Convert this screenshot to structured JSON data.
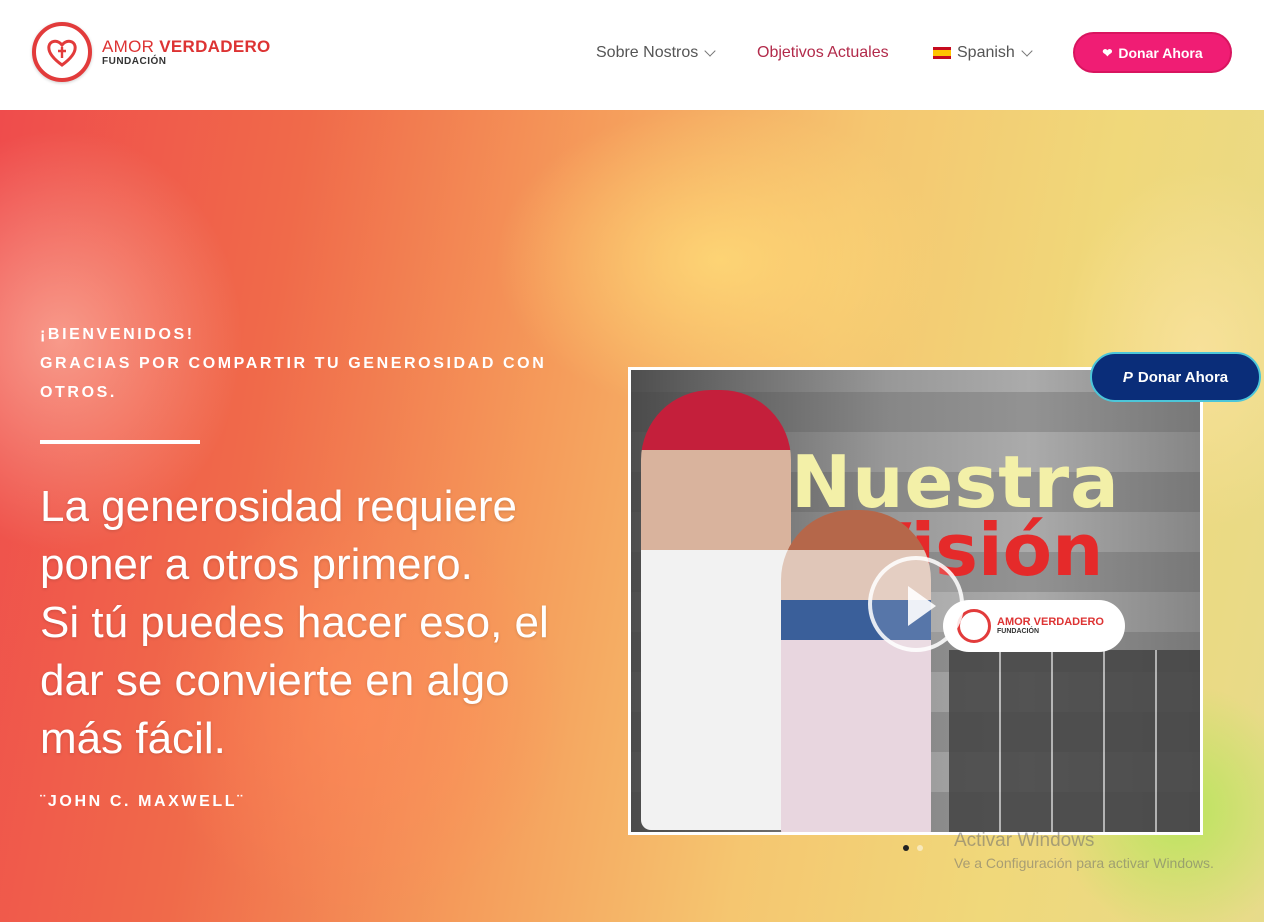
{
  "brand": {
    "name_light": "AMOR",
    "name_bold": "VERDADERO",
    "sub": "FUNDACIÓN"
  },
  "nav": {
    "items": [
      {
        "label": "Sobre Nostros",
        "has_dropdown": true
      },
      {
        "label": "Objetivos Actuales",
        "active": true
      },
      {
        "label": "Spanish",
        "has_dropdown": true,
        "flag": "es"
      }
    ],
    "donate_label": "Donar Ahora",
    "donate_color": "#f01d74",
    "active_color": "#b22a4a"
  },
  "hero": {
    "welcome_line1": "¡BIENVENIDOS!",
    "welcome_line2": "GRACIAS POR COMPARTIR TU GENEROSIDAD CON OTROS.",
    "quote_line1": "La generosidad requiere poner a otros primero.",
    "quote_line2": "Si tú puedes hacer eso, el dar se convierte en algo más fácil.",
    "author": "¨JOHN C. MAXWELL¨"
  },
  "video": {
    "title_line1": "Nuestra",
    "title_line2": "Visión",
    "logo_title": "AMOR VERDADERO",
    "logo_sub": "FUNDACIÓN",
    "play_icon": "play-icon"
  },
  "floating_donate": {
    "label": "Donar Ahora",
    "icon": "paypal-icon",
    "color": "#0a2d79"
  },
  "slider": {
    "active_index": 0,
    "count": 2
  },
  "watermark": {
    "line1": "Activar Windows",
    "line2": "Ve a Configuración para activar Windows."
  }
}
